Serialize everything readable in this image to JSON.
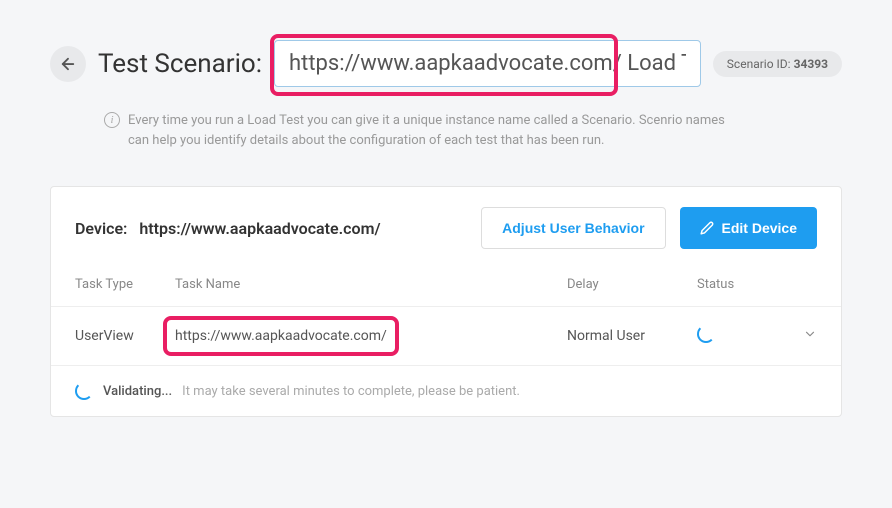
{
  "header": {
    "scenario_label": "Test Scenario:",
    "scenario_value": "https://www.aapkaadvocate.com/ Load Test",
    "scenario_id_label": "Scenario ID:",
    "scenario_id_value": "34393"
  },
  "info": {
    "text": "Every time you run a Load Test you can give it a unique instance name called a Scenario. Scenrio names can help you identify details about the configuration of each test that has been run."
  },
  "device": {
    "label": "Device:",
    "url": "https://www.aapkaadvocate.com/",
    "adjust_button": "Adjust User Behavior",
    "edit_button": "Edit Device"
  },
  "table": {
    "headers": {
      "task_type": "Task Type",
      "task_name": "Task Name",
      "delay": "Delay",
      "status": "Status"
    },
    "row": {
      "task_type": "UserView",
      "task_name": "https://www.aapkaadvocate.com/",
      "delay": "Normal User"
    }
  },
  "validating": {
    "label": "Validating...",
    "message": "It may take several minutes to complete, please be patient."
  }
}
